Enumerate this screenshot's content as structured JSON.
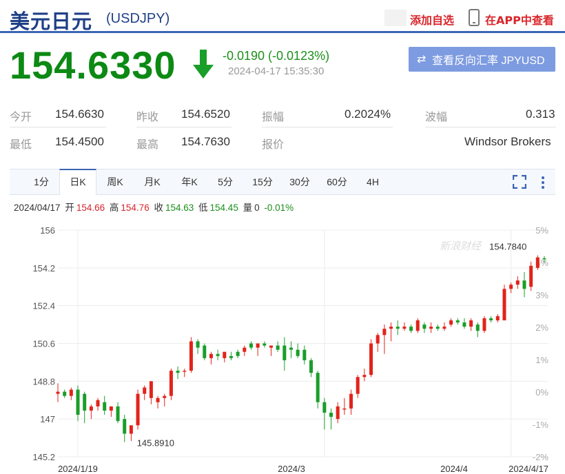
{
  "header": {
    "name": "美元日元",
    "code": "(USDJPY)",
    "add_favorite": "添加自选",
    "open_app": "在APP中查看"
  },
  "quote": {
    "price": "154.6330",
    "change": "-0.0190 (-0.0123%)",
    "timestamp": "2024-04-17 15:35:30",
    "direction": "down",
    "reverse_button": "查看反向汇率 JPYUSD"
  },
  "stats": {
    "row1": [
      {
        "label": "今开",
        "value": "154.6630"
      },
      {
        "label": "昨收",
        "value": "154.6520"
      },
      {
        "label": "振幅",
        "value": "0.2024%"
      },
      {
        "label": "波幅",
        "value": "0.313"
      }
    ],
    "row2": [
      {
        "label": "最低",
        "value": "154.4500"
      },
      {
        "label": "最高",
        "value": "154.7630"
      },
      {
        "label": "报价",
        "value": "Windsor Brokers"
      }
    ]
  },
  "tabs": [
    "1分",
    "日K",
    "周K",
    "月K",
    "年K",
    "5分",
    "15分",
    "30分",
    "60分",
    "4H"
  ],
  "active_tab": "日K",
  "ohlc_bar": {
    "date": "2024/04/17",
    "open_label": "开",
    "open": "154.66",
    "high_label": "高",
    "high": "154.76",
    "close_label": "收",
    "close": "154.63",
    "low_label": "低",
    "low": "154.45",
    "volume_label": "量",
    "volume": "0",
    "change": "-0.01%"
  },
  "colors": {
    "up": "#e2231a",
    "down": "#1a9e2a",
    "brand_blue": "#3a64b4",
    "price_green": "#0c8a14",
    "accent_red": "#d8262b"
  },
  "watermark": "新浪财经",
  "chart_data": {
    "type": "candlestick",
    "ylim": [
      145.2,
      156.0
    ],
    "y_ticks": [
      "156",
      "154.2",
      "152.4",
      "150.6",
      "148.8",
      "147",
      "145.2"
    ],
    "pct_ticks": [
      "5%",
      "4%",
      "3%",
      "2%",
      "1%",
      "0%",
      "-1%",
      "-2%"
    ],
    "x_ticks": [
      "2024/1/19",
      "2024/3",
      "2024/4",
      "2024/4/17"
    ],
    "annotations": [
      {
        "text": "154.7840"
      },
      {
        "text": "145.8910"
      }
    ],
    "candles": [
      {
        "o": 148.2,
        "h": 148.7,
        "l": 147.8,
        "c": 148.3
      },
      {
        "o": 148.3,
        "h": 148.4,
        "l": 148.0,
        "c": 148.1
      },
      {
        "o": 148.1,
        "h": 148.5,
        "l": 147.9,
        "c": 148.4
      },
      {
        "o": 148.4,
        "h": 148.6,
        "l": 146.9,
        "c": 147.2
      },
      {
        "o": 148.2,
        "h": 148.3,
        "l": 146.8,
        "c": 147.4
      },
      {
        "o": 147.4,
        "h": 147.7,
        "l": 147.0,
        "c": 147.6
      },
      {
        "o": 147.6,
        "h": 148.0,
        "l": 147.4,
        "c": 147.9
      },
      {
        "o": 147.8,
        "h": 148.1,
        "l": 147.2,
        "c": 147.4
      },
      {
        "o": 147.4,
        "h": 147.6,
        "l": 147.1,
        "c": 147.6
      },
      {
        "o": 147.6,
        "h": 147.8,
        "l": 146.8,
        "c": 146.9
      },
      {
        "o": 147.0,
        "h": 147.2,
        "l": 145.9,
        "c": 146.3
      },
      {
        "o": 146.3,
        "h": 146.4,
        "l": 145.95,
        "c": 146.7
      },
      {
        "o": 146.7,
        "h": 148.4,
        "l": 146.5,
        "c": 148.2
      },
      {
        "o": 148.2,
        "h": 148.6,
        "l": 147.9,
        "c": 148.5
      },
      {
        "o": 148.0,
        "h": 148.8,
        "l": 147.7,
        "c": 148.8
      },
      {
        "o": 147.8,
        "h": 148.1,
        "l": 147.5,
        "c": 148.0
      },
      {
        "o": 148.0,
        "h": 148.2,
        "l": 147.6,
        "c": 148.1
      },
      {
        "o": 148.1,
        "h": 149.4,
        "l": 147.9,
        "c": 149.3
      },
      {
        "o": 149.3,
        "h": 149.5,
        "l": 148.9,
        "c": 149.2
      },
      {
        "o": 149.3,
        "h": 149.4,
        "l": 149.0,
        "c": 149.3
      },
      {
        "o": 149.3,
        "h": 150.9,
        "l": 149.2,
        "c": 150.7
      },
      {
        "o": 150.7,
        "h": 150.8,
        "l": 150.1,
        "c": 150.4
      },
      {
        "o": 150.5,
        "h": 150.6,
        "l": 149.8,
        "c": 149.9
      },
      {
        "o": 149.9,
        "h": 150.2,
        "l": 149.6,
        "c": 150.1
      },
      {
        "o": 150.1,
        "h": 150.3,
        "l": 149.8,
        "c": 150.0
      },
      {
        "o": 149.9,
        "h": 150.2,
        "l": 149.7,
        "c": 150.2
      },
      {
        "o": 150.0,
        "h": 150.2,
        "l": 149.8,
        "c": 149.9
      },
      {
        "o": 150.2,
        "h": 150.3,
        "l": 149.9,
        "c": 150.0
      },
      {
        "o": 150.2,
        "h": 150.5,
        "l": 150.0,
        "c": 150.4
      },
      {
        "o": 150.6,
        "h": 150.7,
        "l": 150.3,
        "c": 150.4
      },
      {
        "o": 150.4,
        "h": 150.6,
        "l": 150.0,
        "c": 150.6
      },
      {
        "o": 150.6,
        "h": 150.7,
        "l": 150.4,
        "c": 150.5
      },
      {
        "o": 150.4,
        "h": 150.5,
        "l": 150.0,
        "c": 150.5
      },
      {
        "o": 150.5,
        "h": 150.7,
        "l": 150.2,
        "c": 150.3
      },
      {
        "o": 150.5,
        "h": 150.9,
        "l": 149.3,
        "c": 149.8
      },
      {
        "o": 150.4,
        "h": 150.7,
        "l": 149.9,
        "c": 150.3
      },
      {
        "o": 150.3,
        "h": 150.6,
        "l": 149.9,
        "c": 150.0
      },
      {
        "o": 150.3,
        "h": 150.5,
        "l": 149.6,
        "c": 149.8
      },
      {
        "o": 149.8,
        "h": 149.9,
        "l": 149.0,
        "c": 149.2
      },
      {
        "o": 149.2,
        "h": 149.3,
        "l": 147.5,
        "c": 147.8
      },
      {
        "o": 147.8,
        "h": 148.0,
        "l": 146.5,
        "c": 147.3
      },
      {
        "o": 147.3,
        "h": 147.5,
        "l": 146.5,
        "c": 147.1
      },
      {
        "o": 147.0,
        "h": 147.8,
        "l": 146.8,
        "c": 147.6
      },
      {
        "o": 147.5,
        "h": 148.0,
        "l": 147.2,
        "c": 147.5
      },
      {
        "o": 147.5,
        "h": 148.4,
        "l": 147.2,
        "c": 148.2
      },
      {
        "o": 148.2,
        "h": 149.1,
        "l": 148.0,
        "c": 149.0
      },
      {
        "o": 149.0,
        "h": 149.4,
        "l": 148.8,
        "c": 149.1
      },
      {
        "o": 149.1,
        "h": 150.8,
        "l": 149.0,
        "c": 150.6
      },
      {
        "o": 150.6,
        "h": 151.1,
        "l": 150.2,
        "c": 151.0
      },
      {
        "o": 151.0,
        "h": 151.5,
        "l": 150.1,
        "c": 151.3
      },
      {
        "o": 151.3,
        "h": 151.6,
        "l": 150.7,
        "c": 151.4
      },
      {
        "o": 151.4,
        "h": 151.7,
        "l": 151.0,
        "c": 151.3
      },
      {
        "o": 151.3,
        "h": 151.6,
        "l": 151.2,
        "c": 151.4
      },
      {
        "o": 151.4,
        "h": 151.5,
        "l": 151.1,
        "c": 151.2
      },
      {
        "o": 151.2,
        "h": 151.8,
        "l": 151.1,
        "c": 151.7
      },
      {
        "o": 151.5,
        "h": 151.6,
        "l": 151.1,
        "c": 151.3
      },
      {
        "o": 151.3,
        "h": 151.6,
        "l": 151.1,
        "c": 151.4
      },
      {
        "o": 151.4,
        "h": 151.5,
        "l": 151.2,
        "c": 151.3
      },
      {
        "o": 151.3,
        "h": 151.6,
        "l": 151.2,
        "c": 151.4
      },
      {
        "o": 151.5,
        "h": 151.8,
        "l": 151.4,
        "c": 151.7
      },
      {
        "o": 151.7,
        "h": 151.8,
        "l": 151.5,
        "c": 151.6
      },
      {
        "o": 151.6,
        "h": 151.8,
        "l": 151.3,
        "c": 151.4
      },
      {
        "o": 151.4,
        "h": 151.8,
        "l": 151.2,
        "c": 151.7
      },
      {
        "o": 151.5,
        "h": 151.6,
        "l": 150.9,
        "c": 151.2
      },
      {
        "o": 151.2,
        "h": 151.9,
        "l": 151.1,
        "c": 151.8
      },
      {
        "o": 151.8,
        "h": 151.9,
        "l": 151.6,
        "c": 151.7
      },
      {
        "o": 151.7,
        "h": 152.0,
        "l": 151.6,
        "c": 151.9
      },
      {
        "o": 151.7,
        "h": 153.4,
        "l": 151.7,
        "c": 153.2
      },
      {
        "o": 153.2,
        "h": 153.5,
        "l": 153.0,
        "c": 153.4
      },
      {
        "o": 153.4,
        "h": 153.8,
        "l": 153.2,
        "c": 153.6
      },
      {
        "o": 153.6,
        "h": 154.0,
        "l": 152.8,
        "c": 153.2
      },
      {
        "o": 153.3,
        "h": 154.5,
        "l": 153.1,
        "c": 154.3
      },
      {
        "o": 154.2,
        "h": 154.8,
        "l": 154.1,
        "c": 154.7
      },
      {
        "o": 154.66,
        "h": 154.76,
        "l": 154.45,
        "c": 154.63
      }
    ]
  }
}
